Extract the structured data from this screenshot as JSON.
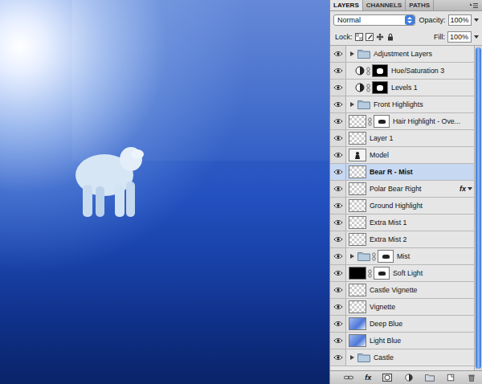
{
  "panel": {
    "tabs": [
      {
        "label": "LAYERS",
        "selected": true
      },
      {
        "label": "CHANNELS",
        "selected": false
      },
      {
        "label": "PATHS",
        "selected": false
      }
    ],
    "blend_mode": "Normal",
    "opacity": {
      "label": "Opacity:",
      "value": "100%"
    },
    "lock": {
      "label": "Lock:"
    },
    "fill": {
      "label": "Fill:",
      "value": "100%"
    },
    "layers": [
      {
        "name": "Adjustment Layers",
        "kind": "group",
        "thumb": "folder",
        "mask": "none",
        "expanded": false,
        "visible": true,
        "selected": false,
        "fx": ""
      },
      {
        "name": "Hue/Saturation 3",
        "kind": "adjustment",
        "thumb": "adjustment",
        "mask": "dark",
        "expanded": false,
        "visible": true,
        "selected": false,
        "fx": ""
      },
      {
        "name": "Levels 1",
        "kind": "adjustment",
        "thumb": "adjustment",
        "mask": "dark",
        "expanded": false,
        "visible": true,
        "selected": false,
        "fx": ""
      },
      {
        "name": "Front Highlights",
        "kind": "group",
        "thumb": "folder",
        "mask": "none",
        "expanded": false,
        "visible": true,
        "selected": false,
        "fx": ""
      },
      {
        "name": "Hair Highlight - Ove...",
        "kind": "pixel",
        "thumb": "transparent",
        "mask": "light",
        "expanded": false,
        "visible": true,
        "selected": false,
        "fx": ""
      },
      {
        "name": "Layer 1",
        "kind": "pixel",
        "thumb": "transparent",
        "mask": "none",
        "expanded": false,
        "visible": true,
        "selected": false,
        "fx": ""
      },
      {
        "name": "Model",
        "kind": "pixel",
        "thumb": "figure",
        "mask": "none",
        "expanded": false,
        "visible": true,
        "selected": false,
        "fx": ""
      },
      {
        "name": "Bear R - Mist",
        "kind": "pixel",
        "thumb": "transparent",
        "mask": "none",
        "expanded": false,
        "visible": true,
        "selected": true,
        "fx": ""
      },
      {
        "name": "Polar Bear Right",
        "kind": "pixel",
        "thumb": "transparent",
        "mask": "none",
        "expanded": false,
        "visible": true,
        "selected": false,
        "fx": "fx"
      },
      {
        "name": "Ground Highlight",
        "kind": "pixel",
        "thumb": "transparent",
        "mask": "none",
        "expanded": false,
        "visible": true,
        "selected": false,
        "fx": ""
      },
      {
        "name": "Extra Mist 1",
        "kind": "pixel",
        "thumb": "transparent",
        "mask": "none",
        "expanded": false,
        "visible": true,
        "selected": false,
        "fx": ""
      },
      {
        "name": "Extra Mist 2",
        "kind": "pixel",
        "thumb": "transparent",
        "mask": "none",
        "expanded": false,
        "visible": true,
        "selected": false,
        "fx": ""
      },
      {
        "name": "Mist",
        "kind": "group",
        "thumb": "folder",
        "mask": "light",
        "expanded": false,
        "visible": true,
        "selected": false,
        "fx": ""
      },
      {
        "name": "Soft Light",
        "kind": "pixel",
        "thumb": "black",
        "mask": "light",
        "expanded": false,
        "visible": true,
        "selected": false,
        "fx": ""
      },
      {
        "name": "Castle Vignette",
        "kind": "pixel",
        "thumb": "transparent",
        "mask": "none",
        "expanded": false,
        "visible": true,
        "selected": false,
        "fx": ""
      },
      {
        "name": "Vignette",
        "kind": "pixel",
        "thumb": "transparent",
        "mask": "none",
        "expanded": false,
        "visible": true,
        "selected": false,
        "fx": ""
      },
      {
        "name": "Deep Blue",
        "kind": "pixel",
        "thumb": "blue",
        "mask": "none",
        "expanded": false,
        "visible": true,
        "selected": false,
        "fx": ""
      },
      {
        "name": "Light Blue",
        "kind": "pixel",
        "thumb": "blue",
        "mask": "none",
        "expanded": false,
        "visible": true,
        "selected": false,
        "fx": ""
      },
      {
        "name": "Castle",
        "kind": "group",
        "thumb": "folder",
        "mask": "none",
        "expanded": false,
        "visible": true,
        "selected": false,
        "fx": ""
      }
    ],
    "footer": {
      "fx": "fx"
    }
  }
}
